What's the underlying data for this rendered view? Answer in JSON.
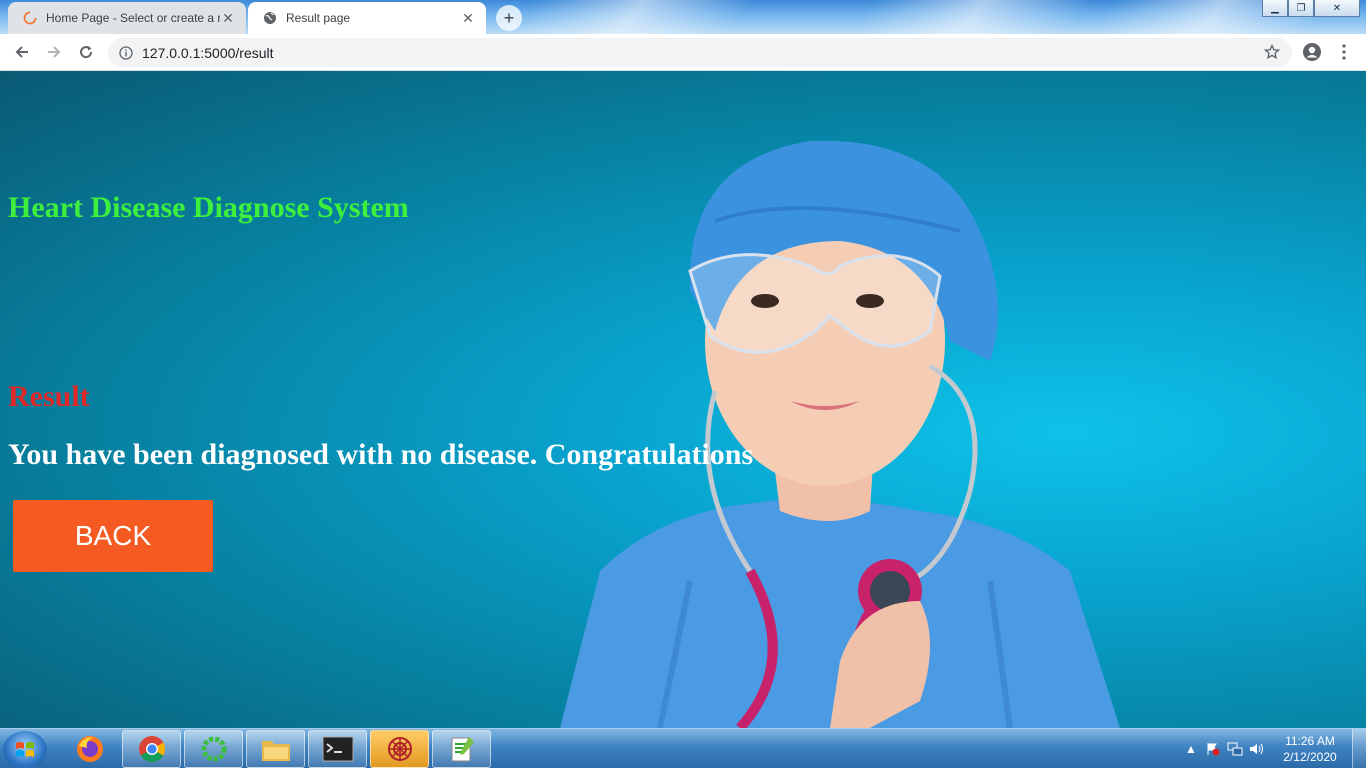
{
  "browser": {
    "tabs": [
      {
        "title": "Home Page - Select or create a n",
        "icon": "loading-spinner-icon",
        "active": false
      },
      {
        "title": "Result page",
        "icon": "globe-icon",
        "active": true
      }
    ],
    "url": "127.0.0.1:5000/result"
  },
  "page": {
    "heading": "Heart Disease Diagnose System",
    "result_heading": "Result",
    "result_message": "You have been diagnosed with no disease. Congratulations",
    "back_button": "BACK",
    "colors": {
      "heading": "#3df03d",
      "result_heading": "#e02a2a",
      "button": "#f45a22"
    }
  },
  "taskbar": {
    "apps": [
      "firefox-icon",
      "chrome-icon",
      "green-ring-icon",
      "file-explorer-icon",
      "terminal-icon",
      "spider-web-icon",
      "notepad-plus-plus-icon"
    ],
    "clock_time": "11:26 AM",
    "clock_date": "2/12/2020"
  }
}
